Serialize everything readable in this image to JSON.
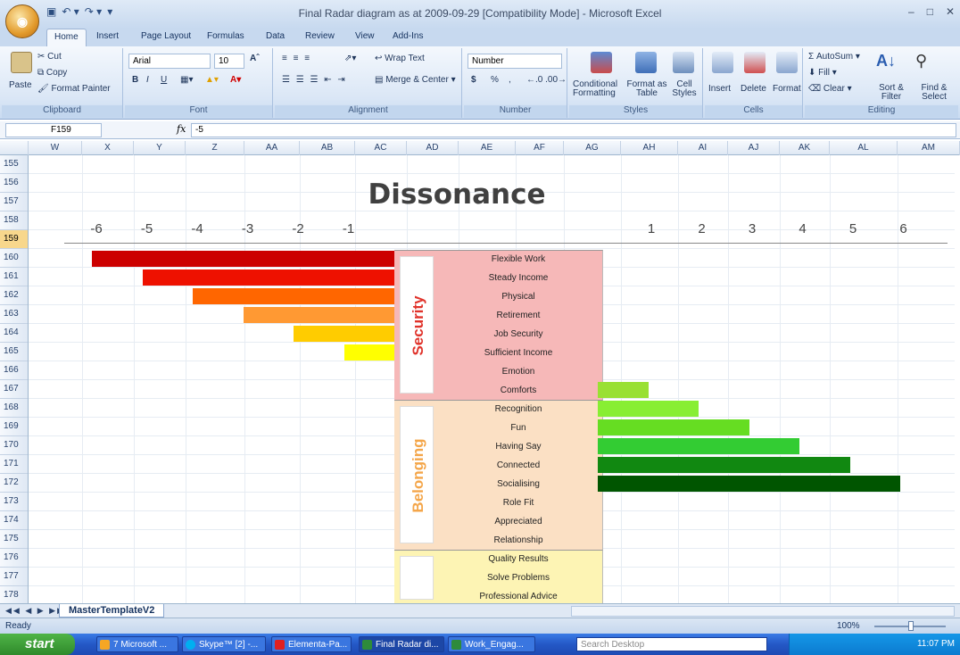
{
  "window": {
    "title": "Final Radar diagram as at 2009-09-29  [Compatibility Mode] - Microsoft Excel",
    "office_button": "◉",
    "qat": [
      "▣",
      "↶ ▾",
      "↷ ▾",
      "▾"
    ],
    "controls": [
      "–",
      "□",
      "✕"
    ]
  },
  "ribbon_tabs": [
    "Home",
    "Insert",
    "Page Layout",
    "Formulas",
    "Data",
    "Review",
    "View",
    "Add-Ins"
  ],
  "ribbon": {
    "clipboard": {
      "label": "Clipboard",
      "paste": "Paste",
      "cut": "Cut",
      "copy": "Copy",
      "format_painter": "Format Painter"
    },
    "font": {
      "label": "Font",
      "name": "Arial",
      "size": "10",
      "bold": "B",
      "italic": "I",
      "underline": "U"
    },
    "alignment": {
      "label": "Alignment",
      "wrap": "Wrap Text",
      "merge": "Merge & Center"
    },
    "number": {
      "label": "Number",
      "format": "Number",
      "currency": "$",
      "percent": "%",
      "comma": ","
    },
    "styles": {
      "label": "Styles",
      "conditional": "Conditional Formatting",
      "format_table": "Format as Table",
      "cell_styles": "Cell Styles"
    },
    "cells": {
      "label": "Cells",
      "insert": "Insert",
      "delete": "Delete",
      "format": "Format"
    },
    "editing": {
      "label": "Editing",
      "autosum": "AutoSum",
      "fill": "Fill",
      "clear": "Clear",
      "sort": "Sort & Filter",
      "find": "Find & Select"
    }
  },
  "formula_bar": {
    "name_box": "F159",
    "fx": "fx",
    "formula": "-5"
  },
  "columns": [
    "W",
    "X",
    "Y",
    "Z",
    "AA",
    "AB",
    "AC",
    "AD",
    "AE",
    "AF",
    "AG",
    "AH",
    "AI",
    "AJ",
    "AK",
    "AL",
    "AM"
  ],
  "rows": [
    "155",
    "156",
    "157",
    "158",
    "159",
    "160",
    "161",
    "162",
    "163",
    "164",
    "165",
    "166",
    "167",
    "168",
    "169",
    "170",
    "171",
    "172",
    "173",
    "174",
    "175",
    "176",
    "177",
    "178"
  ],
  "selected_row": "159",
  "chart_data": {
    "type": "bar",
    "title": "Dissonance",
    "xlim": [
      -6,
      6
    ],
    "ticks_neg": [
      "-6",
      "-5",
      "-4",
      "-3",
      "-2",
      "-1"
    ],
    "ticks_pos": [
      "1",
      "2",
      "3",
      "4",
      "5",
      "6"
    ],
    "groups": [
      {
        "name": "Security",
        "color": "#e0332b",
        "bg": "#f6b8b8",
        "items": [
          "Flexible Work",
          "Steady Income",
          "Physical",
          "Retirement",
          "Job Security",
          "Sufficient Income",
          "Emotion",
          "Comforts"
        ]
      },
      {
        "name": "Belonging",
        "color": "#f4a64a",
        "bg": "#fbe0c4",
        "items": [
          "Recognition",
          "Fun",
          "Having Say",
          "Connected",
          "Socialising",
          "Role Fit",
          "Appreciated",
          "Relationship"
        ]
      },
      {
        "name": "",
        "color": "#d8c23a",
        "bg": "#fdf4b4",
        "items": [
          "Quality Results",
          "Solve Problems",
          "Professional Advice"
        ]
      }
    ],
    "negative_bars": [
      {
        "item": "Flexible Work",
        "value": -6,
        "color": "#cc0000"
      },
      {
        "item": "Steady Income",
        "value": -5,
        "color": "#ee1100"
      },
      {
        "item": "Physical",
        "value": -4,
        "color": "#ff6600"
      },
      {
        "item": "Retirement",
        "value": -3,
        "color": "#ff9933"
      },
      {
        "item": "Job Security",
        "value": -2,
        "color": "#ffcc00"
      },
      {
        "item": "Sufficient Income",
        "value": -1,
        "color": "#ffff00"
      }
    ],
    "positive_bars": [
      {
        "item": "Comforts",
        "value": 1,
        "color": "#99e033"
      },
      {
        "item": "Recognition",
        "value": 2,
        "color": "#88ee33"
      },
      {
        "item": "Fun",
        "value": 3,
        "color": "#66dd22"
      },
      {
        "item": "Having Say",
        "value": 4,
        "color": "#33cc33"
      },
      {
        "item": "Connected",
        "value": 5,
        "color": "#118811"
      },
      {
        "item": "Socialising",
        "value": 6,
        "color": "#005500"
      }
    ]
  },
  "sheet": {
    "nav": "◀◀ ◀ ▶ ▶▶",
    "tab": "MasterTemplateV2"
  },
  "status": {
    "ready": "Ready",
    "zoom": "100%"
  },
  "taskbar": {
    "start": "start",
    "tasks": [
      "7 Microsoft ...",
      "Skype™ [2] -...",
      "Elementa-Pa...",
      "Final Radar di...",
      "Work_Engag..."
    ],
    "search": "Search Desktop",
    "clock": "11:07 PM"
  }
}
